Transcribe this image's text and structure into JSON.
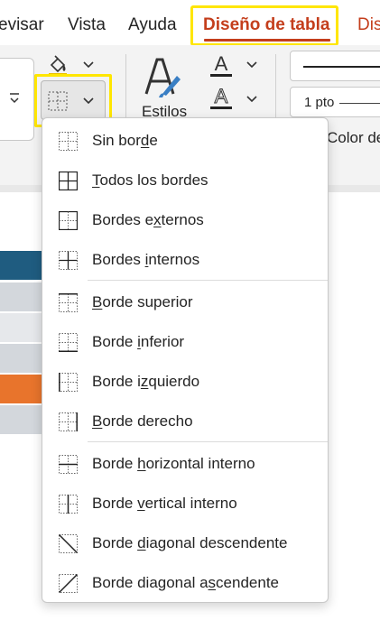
{
  "tabs": [
    {
      "label": "evisar"
    },
    {
      "label": "Vista"
    },
    {
      "label": "Ayuda"
    },
    {
      "label": "Diseño de tabla"
    },
    {
      "label": "Dis"
    }
  ],
  "ribbon": {
    "styles_label": "Estilos",
    "pen_weight": "1 pto",
    "pen_color_label": "Color de"
  },
  "colors": {
    "accent": "#c43e1c",
    "highlight": "#ffe600",
    "table_header": "#1f5c80",
    "table_accent": "#e8742c",
    "table_band": "#d3d7dc"
  },
  "menu": {
    "items": [
      {
        "pre": "Sin bor",
        "u": "d",
        "post": "e",
        "icon": "no-border-icon"
      },
      {
        "pre": "",
        "u": "T",
        "post": "odos los bordes",
        "icon": "all-borders-icon"
      },
      {
        "pre": "Bordes e",
        "u": "x",
        "post": "ternos",
        "icon": "outside-borders-icon"
      },
      {
        "pre": "Bordes ",
        "u": "i",
        "post": "nternos",
        "icon": "inside-borders-icon"
      },
      {
        "pre": "",
        "u": "B",
        "post": "orde superior",
        "icon": "top-border-icon"
      },
      {
        "pre": "Borde ",
        "u": "i",
        "post": "nferior",
        "icon": "bottom-border-icon"
      },
      {
        "pre": "Borde i",
        "u": "z",
        "post": "quierdo",
        "icon": "left-border-icon"
      },
      {
        "pre": "",
        "u": "B",
        "post": "orde derecho",
        "icon": "right-border-icon"
      },
      {
        "pre": "Borde ",
        "u": "h",
        "post": "orizontal interno",
        "icon": "inside-horizontal-border-icon"
      },
      {
        "pre": "Borde ",
        "u": "v",
        "post": "ertical interno",
        "icon": "inside-vertical-border-icon"
      },
      {
        "pre": "Borde ",
        "u": "d",
        "post": "iagonal descendente",
        "icon": "diagonal-down-border-icon"
      },
      {
        "pre": "Borde diagonal a",
        "u": "s",
        "post": "cendente",
        "icon": "diagonal-up-border-icon"
      }
    ]
  }
}
